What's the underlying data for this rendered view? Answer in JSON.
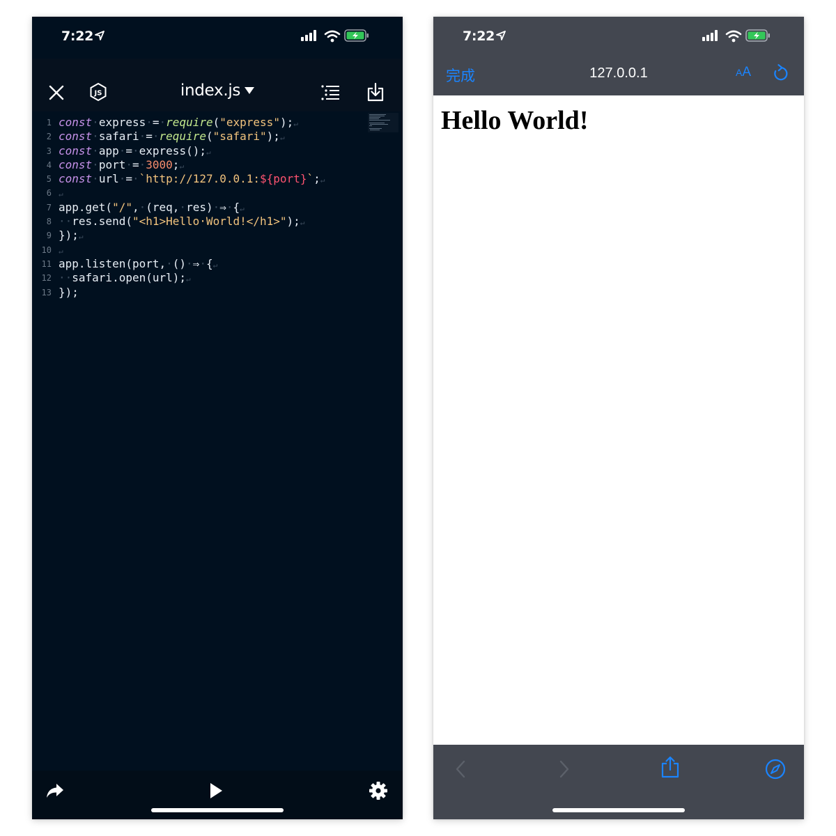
{
  "editor": {
    "status": {
      "time": "7:22"
    },
    "toolbar": {
      "file_name": "index.js"
    },
    "code_lines": [
      {
        "num": "1",
        "tokens": [
          {
            "t": "const",
            "c": "kw"
          },
          {
            "t": "·",
            "c": "ws"
          },
          {
            "t": "express",
            "c": "id"
          },
          {
            "t": "·",
            "c": "ws"
          },
          {
            "t": "=",
            "c": "op"
          },
          {
            "t": "·",
            "c": "ws"
          },
          {
            "t": "require",
            "c": "fn"
          },
          {
            "t": "(",
            "c": "op"
          },
          {
            "t": "\"express\"",
            "c": "str"
          },
          {
            "t": ");",
            "c": "op"
          },
          {
            "t": "↵",
            "c": "eol"
          }
        ]
      },
      {
        "num": "2",
        "tokens": [
          {
            "t": "const",
            "c": "kw"
          },
          {
            "t": "·",
            "c": "ws"
          },
          {
            "t": "safari",
            "c": "id"
          },
          {
            "t": "·",
            "c": "ws"
          },
          {
            "t": "=",
            "c": "op"
          },
          {
            "t": "·",
            "c": "ws"
          },
          {
            "t": "require",
            "c": "fn"
          },
          {
            "t": "(",
            "c": "op"
          },
          {
            "t": "\"safari\"",
            "c": "str"
          },
          {
            "t": ");",
            "c": "op"
          },
          {
            "t": "↵",
            "c": "eol"
          }
        ]
      },
      {
        "num": "3",
        "tokens": [
          {
            "t": "const",
            "c": "kw"
          },
          {
            "t": "·",
            "c": "ws"
          },
          {
            "t": "app",
            "c": "id"
          },
          {
            "t": "·",
            "c": "ws"
          },
          {
            "t": "=",
            "c": "op"
          },
          {
            "t": "·",
            "c": "ws"
          },
          {
            "t": "express();",
            "c": "id"
          },
          {
            "t": "↵",
            "c": "eol"
          }
        ]
      },
      {
        "num": "4",
        "tokens": [
          {
            "t": "const",
            "c": "kw"
          },
          {
            "t": "·",
            "c": "ws"
          },
          {
            "t": "port",
            "c": "id"
          },
          {
            "t": "·",
            "c": "ws"
          },
          {
            "t": "=",
            "c": "op"
          },
          {
            "t": "·",
            "c": "ws"
          },
          {
            "t": "3000",
            "c": "num"
          },
          {
            "t": ";",
            "c": "op"
          },
          {
            "t": "↵",
            "c": "eol"
          }
        ]
      },
      {
        "num": "5",
        "tokens": [
          {
            "t": "const",
            "c": "kw"
          },
          {
            "t": "·",
            "c": "ws"
          },
          {
            "t": "url",
            "c": "id"
          },
          {
            "t": "·",
            "c": "ws"
          },
          {
            "t": "=",
            "c": "op"
          },
          {
            "t": "·",
            "c": "ws"
          },
          {
            "t": "`http://127.0.0.1:",
            "c": "tpl"
          },
          {
            "t": "${port}",
            "c": "interp"
          },
          {
            "t": "`",
            "c": "tpl"
          },
          {
            "t": ";",
            "c": "op"
          },
          {
            "t": "↵",
            "c": "eol"
          }
        ]
      },
      {
        "num": "6",
        "tokens": [
          {
            "t": "↵",
            "c": "eol"
          }
        ]
      },
      {
        "num": "7",
        "tokens": [
          {
            "t": "app.get(",
            "c": "id"
          },
          {
            "t": "\"/\"",
            "c": "str"
          },
          {
            "t": ",",
            "c": "op"
          },
          {
            "t": "·",
            "c": "ws"
          },
          {
            "t": "(req,",
            "c": "id"
          },
          {
            "t": "·",
            "c": "ws"
          },
          {
            "t": "res)",
            "c": "id"
          },
          {
            "t": "·",
            "c": "ws"
          },
          {
            "t": "⇒",
            "c": "op"
          },
          {
            "t": "·",
            "c": "ws"
          },
          {
            "t": "{",
            "c": "op"
          },
          {
            "t": "↵",
            "c": "eol"
          }
        ]
      },
      {
        "num": "8",
        "tokens": [
          {
            "t": "··",
            "c": "ws"
          },
          {
            "t": "res.send(",
            "c": "id"
          },
          {
            "t": "\"<h1>Hello·World!</h1>\"",
            "c": "str"
          },
          {
            "t": ");",
            "c": "op"
          },
          {
            "t": "↵",
            "c": "eol"
          }
        ]
      },
      {
        "num": "9",
        "tokens": [
          {
            "t": "});",
            "c": "op"
          },
          {
            "t": "↵",
            "c": "eol"
          }
        ]
      },
      {
        "num": "10",
        "tokens": [
          {
            "t": "↵",
            "c": "eol"
          }
        ]
      },
      {
        "num": "11",
        "tokens": [
          {
            "t": "app.listen(port,",
            "c": "id"
          },
          {
            "t": "·",
            "c": "ws"
          },
          {
            "t": "()",
            "c": "id"
          },
          {
            "t": "·",
            "c": "ws"
          },
          {
            "t": "⇒",
            "c": "op"
          },
          {
            "t": "·",
            "c": "ws"
          },
          {
            "t": "{",
            "c": "op"
          },
          {
            "t": "↵",
            "c": "eol"
          }
        ]
      },
      {
        "num": "12",
        "tokens": [
          {
            "t": "··",
            "c": "ws"
          },
          {
            "t": "safari.open(url);",
            "c": "id"
          },
          {
            "t": "↵",
            "c": "eol"
          }
        ]
      },
      {
        "num": "13",
        "tokens": [
          {
            "t": "});",
            "c": "op"
          }
        ]
      }
    ]
  },
  "browser": {
    "status": {
      "time": "7:22"
    },
    "toolbar": {
      "done_label": "完成",
      "url": "127.0.0.1",
      "text_size_label_small": "A",
      "text_size_label_large": "A"
    },
    "page": {
      "heading": "Hello World!"
    }
  },
  "colors": {
    "editor_bg": "#01101f",
    "browser_chrome": "#434750",
    "accent_blue": "#1a84ff",
    "battery_green": "#33c759"
  },
  "icons": {
    "editor": [
      "close-icon",
      "nodejs-icon",
      "list-icon",
      "download-icon",
      "share-icon",
      "play-icon",
      "gear-icon"
    ],
    "browser": [
      "refresh-icon",
      "back-icon",
      "forward-icon",
      "share-icon",
      "compass-icon"
    ]
  }
}
